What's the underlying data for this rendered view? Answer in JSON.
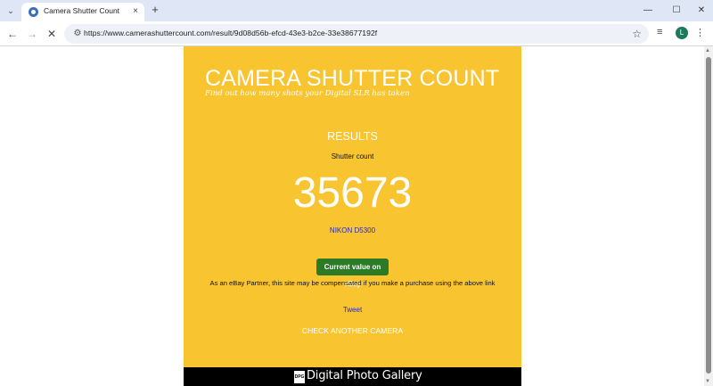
{
  "browser": {
    "tab_title": "Camera Shutter Count",
    "tab_close": "×",
    "new_tab": "+",
    "tab_menu": "⌄",
    "url": "https://www.camerashuttercount.com/result/9d08d56b-efcd-43e3-b2ce-33e38677192f",
    "avatar_letter": "L",
    "icons": {
      "back": "←",
      "forward": "→",
      "stop": "✕",
      "tune": "⚙",
      "star": "☆",
      "media": "≡",
      "kebab": "⋮",
      "minimize": "—",
      "maximize": "☐",
      "close": "✕"
    }
  },
  "page": {
    "site_title": "CAMERA SHUTTER COUNT",
    "tagline": "Find out how many shots your Digital SLR has taken",
    "results_heading": "RESULTS",
    "shutter_label": "Shutter count",
    "shutter_count": "35673",
    "camera_model": "NIKON D5300",
    "ebay_button": "Current value on eBay",
    "affiliate_note": "As an eBay Partner, this site may be compensated if you make a purchase using the above link",
    "tweet_link": "Tweet",
    "check_another": "CHECK ANOTHER CAMERA",
    "footer_brand": "Digital Photo Gallery"
  },
  "colors": {
    "panel": "#f8c42f",
    "button": "#2b7a26",
    "link": "#2a2ab8",
    "footer": "#000000"
  }
}
